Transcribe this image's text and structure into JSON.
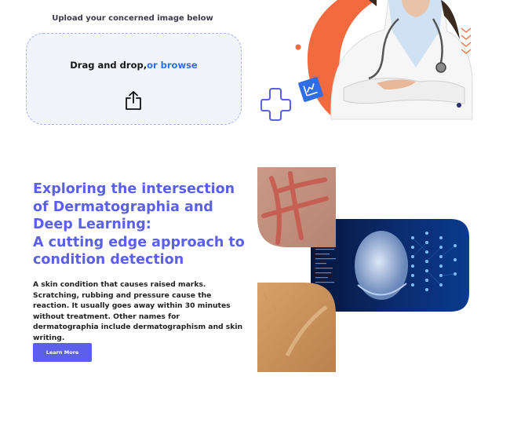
{
  "upload": {
    "caption": "Upload your concerned image below",
    "drop_text": "Drag and drop,",
    "browse_text": "or browse",
    "upload_icon": "upload-icon"
  },
  "hero": {
    "accent_color": "#f26a3d",
    "brand_color": "#5b5fe9",
    "icons": [
      "plus-icon",
      "chart-badge-icon"
    ]
  },
  "article": {
    "headline_lines": [
      "Exploring the intersection",
      "of Dermatographia and",
      "Deep Learning:",
      "A cutting edge approach to",
      "condition detection"
    ],
    "body": "A skin condition that causes raised marks. Scratching, rubbing and pressure cause the reaction. It usually goes away within 30 minutes without treatment. Other names for dermatographia include dermatographism and skin writing.",
    "button_label": "Learn More"
  },
  "collage": {
    "images": [
      "skin-scratch-photo",
      "ai-face-photo",
      "skin-writing-arm-photo"
    ]
  },
  "colors": {
    "primary": "#5b5fe9",
    "link": "#2f6ee8",
    "dropzone_bg": "#f2f4fb",
    "dropzone_border": "#a9b2ea"
  }
}
